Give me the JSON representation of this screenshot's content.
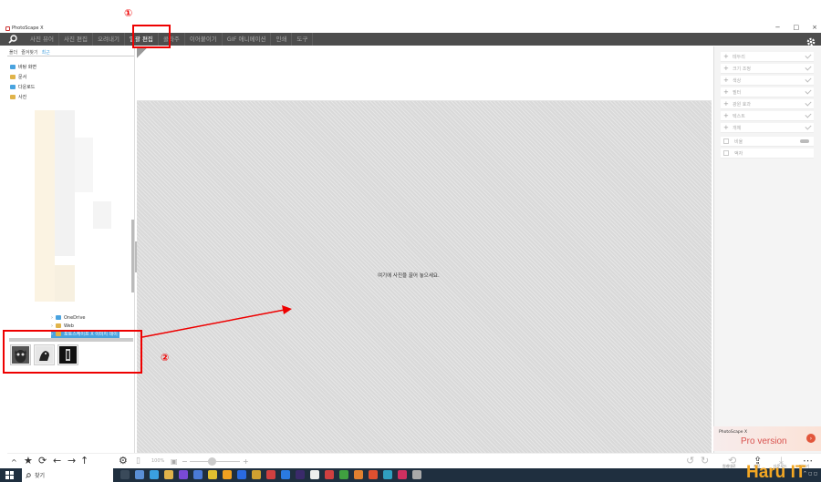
{
  "window": {
    "title": "PhotoScape X",
    "controls": [
      "−",
      "□",
      "×"
    ]
  },
  "menu": {
    "tabs": [
      {
        "label": "사진 뷰어",
        "active": false
      },
      {
        "label": "사진 편집",
        "active": false
      },
      {
        "label": "오려내기",
        "active": false
      },
      {
        "label": "일괄 편집",
        "active": true
      },
      {
        "label": "콜라주",
        "active": false
      },
      {
        "label": "이어붙이기",
        "active": false
      },
      {
        "label": "GIF 애니메이션",
        "active": false
      },
      {
        "label": "인쇄",
        "active": false
      },
      {
        "label": "도구",
        "active": false
      }
    ]
  },
  "sidebar": {
    "tabs": [
      "폴더",
      "즐겨찾기",
      "최근"
    ],
    "folders": [
      {
        "label": "바탕 화면",
        "color": "#4aa3df"
      },
      {
        "label": "문서",
        "color": "#e0b34a"
      },
      {
        "label": "다운로드",
        "color": "#4aa3df"
      },
      {
        "label": "사진",
        "color": "#e0b34a"
      }
    ],
    "tree": [
      {
        "label": "OneDrive",
        "color": "#4aa3df",
        "selected": false
      },
      {
        "label": "Web",
        "color": "#e0b34a",
        "selected": false
      },
      {
        "label": "포토스케이프 X 이미지 데이",
        "color": "#e0b34a",
        "selected": true
      }
    ]
  },
  "canvas": {
    "drop_hint": "여기에 사진을 끌어 놓으세요."
  },
  "right_panel": {
    "items": [
      {
        "label": "테두리",
        "type": "plus"
      },
      {
        "label": "크기 조정",
        "type": "plus"
      },
      {
        "label": "색상",
        "type": "plus"
      },
      {
        "label": "필터",
        "type": "plus"
      },
      {
        "label": "광원 효과",
        "type": "plus"
      },
      {
        "label": "텍스트",
        "type": "plus"
      },
      {
        "label": "개체",
        "type": "plus"
      },
      {
        "label": "비율",
        "type": "checkbox"
      },
      {
        "label": "액자",
        "type": "checkbox"
      }
    ],
    "pro_banner": {
      "title": "PhotoScape X",
      "text": "Pro version"
    }
  },
  "bottom": {
    "zoom": "100%",
    "actions": [
      {
        "label": "원래대로",
        "icon": "⟲"
      },
      {
        "label": "저장",
        "icon": "⇪"
      },
      {
        "label": "다운로드",
        "icon": "⤓"
      },
      {
        "label": "더보기",
        "icon": "⋯"
      }
    ]
  },
  "taskbar": {
    "search_placeholder": "찾기"
  },
  "watermark": "Haru IT",
  "annotations": {
    "one": "①",
    "two": "②"
  },
  "colors": {
    "menubar": "#4d4d4d",
    "accent": "#4aa3df",
    "annotation": "#e00000"
  }
}
